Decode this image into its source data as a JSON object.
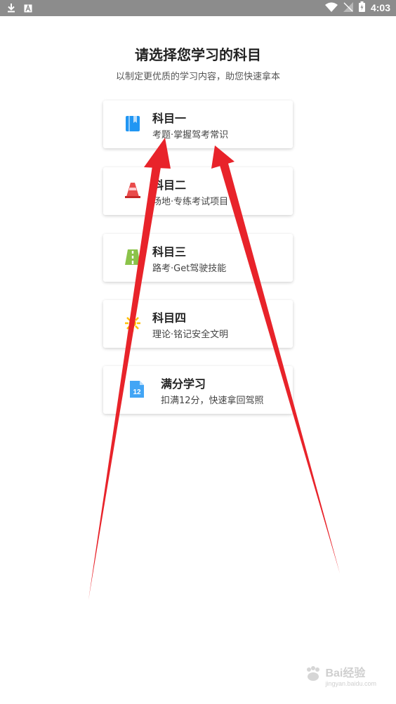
{
  "status_bar": {
    "time": "4:03",
    "icons": [
      "download-icon",
      "font-icon",
      "wifi-icon",
      "signal-icon",
      "battery-icon"
    ]
  },
  "header": {
    "title": "请选择您学习的科目",
    "subtitle": "以制定更优质的学习内容，助您快速拿本"
  },
  "subjects": [
    {
      "name": "科目一",
      "desc": "考题·掌握驾考常识",
      "icon": "book-icon"
    },
    {
      "name": "科目二",
      "desc": "场地·专练考试项目",
      "icon": "traffic-cone-icon"
    },
    {
      "name": "科目三",
      "desc": "路考·Get驾驶技能",
      "icon": "road-icon"
    },
    {
      "name": "科目四",
      "desc": "理论·铭记安全文明",
      "icon": "light-burst-icon"
    },
    {
      "name": "满分学习",
      "desc": "扣满12分，快速拿回驾照",
      "icon": "document-12-icon"
    }
  ],
  "watermark": {
    "brand": "Bai",
    "brand2": "经验",
    "url": "jingyan.baidu.com"
  },
  "colors": {
    "status_bar": "#8c8c8c",
    "arrow": "#e8232a",
    "book_icon": "#2196f3",
    "cone_icon": "#e94b4b",
    "road_icon": "#8bc34a",
    "burst_icon": "#ffc107",
    "doc_icon": "#42a5f5"
  }
}
